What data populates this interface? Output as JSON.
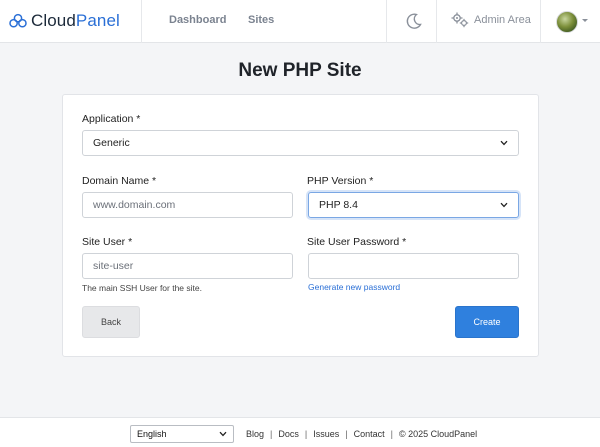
{
  "header": {
    "brand": {
      "part1": "Cloud",
      "part2": "Panel"
    },
    "nav": [
      {
        "label": "Dashboard"
      },
      {
        "label": "Sites"
      }
    ],
    "admin_label": "Admin Area",
    "colors": {
      "brand_blue": "#2a6fd6",
      "brand_dark": "#1c2a3a"
    }
  },
  "page_title": "New PHP Site",
  "form": {
    "application": {
      "label": "Application *",
      "value": "Generic"
    },
    "domain_name": {
      "label": "Domain Name *",
      "placeholder": "www.domain.com"
    },
    "php_version": {
      "label": "PHP Version *",
      "value": "PHP 8.4"
    },
    "site_user": {
      "label": "Site User *",
      "placeholder": "site-user",
      "help": "The main SSH User for the site."
    },
    "site_user_password": {
      "label": "Site User Password *",
      "value": "",
      "generate_link": "Generate new password"
    },
    "back_button": "Back",
    "create_button": "Create",
    "colors": {
      "primary": "#2f80de"
    }
  },
  "footer": {
    "language": "English",
    "links": [
      "Blog",
      "Docs",
      "Issues",
      "Contact"
    ],
    "copyright": "© 2025  CloudPanel"
  }
}
